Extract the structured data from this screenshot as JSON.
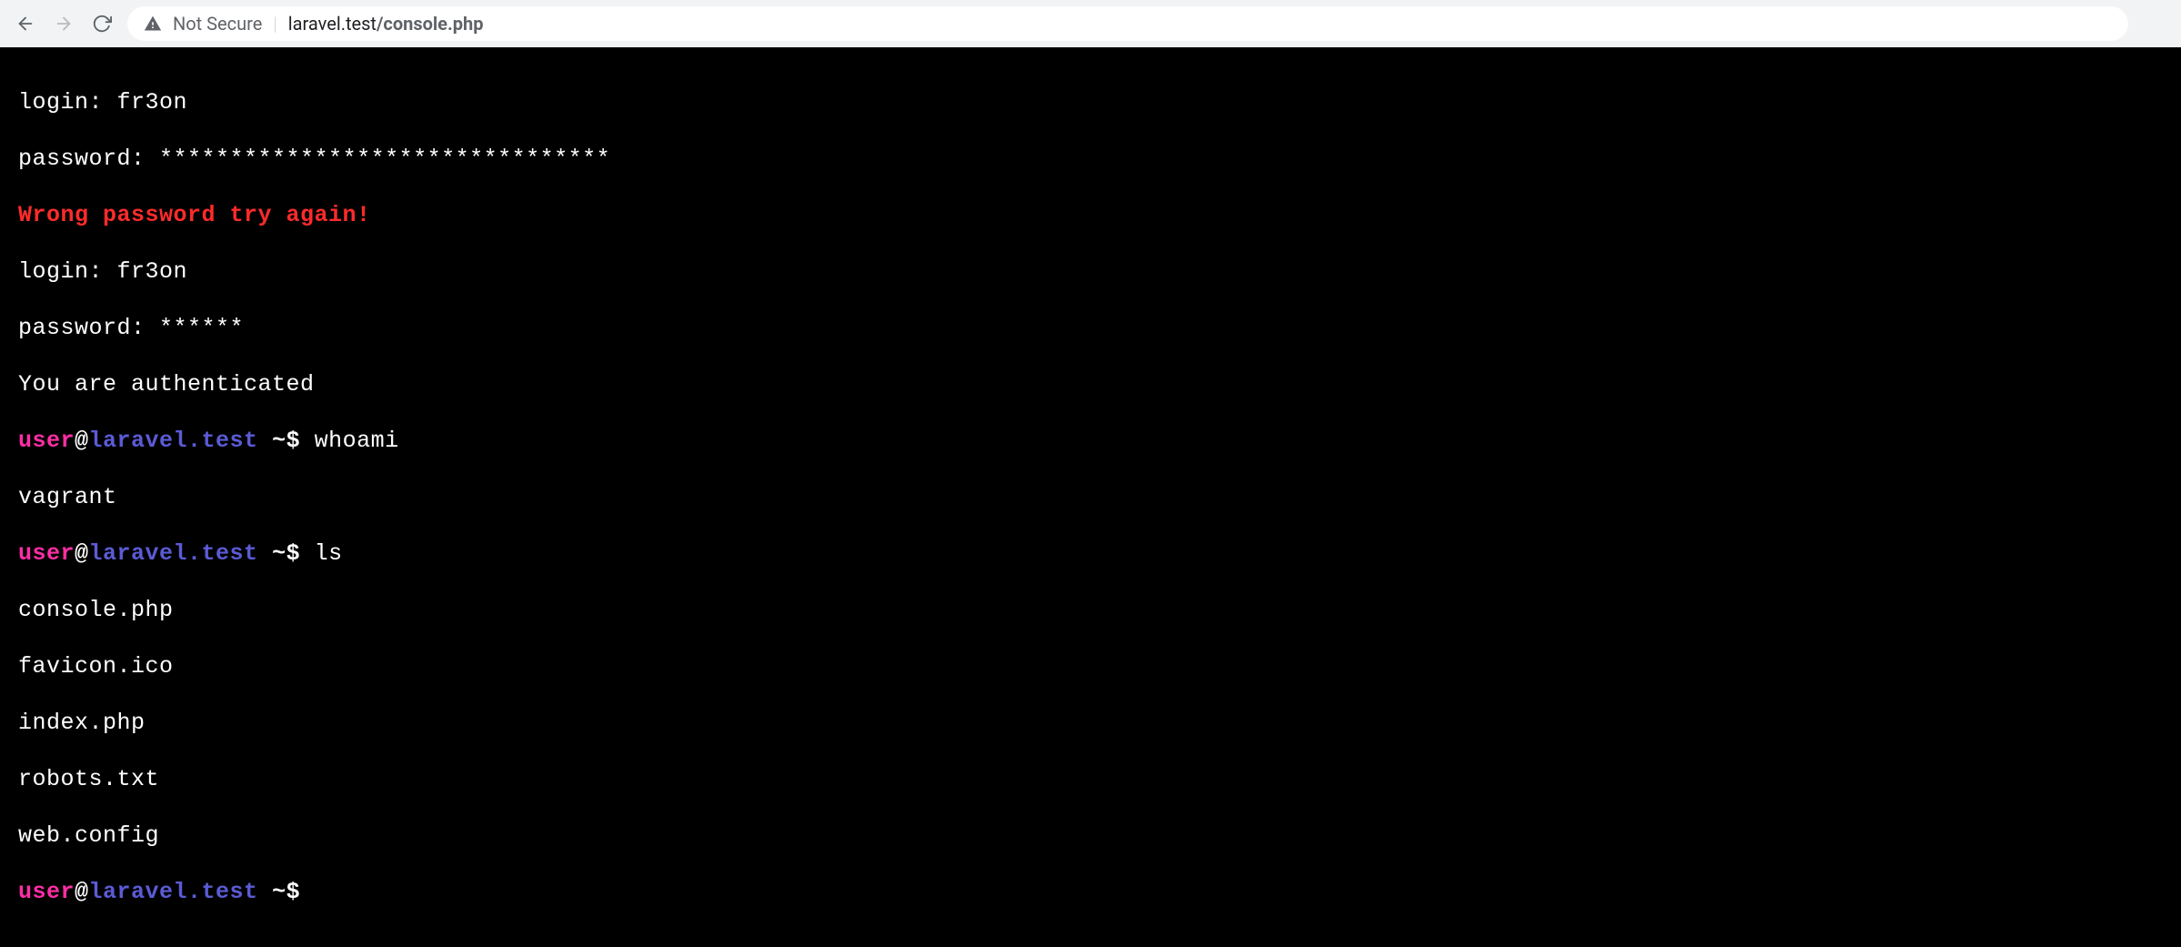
{
  "browser": {
    "security_label": "Not Secure",
    "host": "laravel.test",
    "path": "/console.php"
  },
  "terminal": {
    "login1_label": "login: ",
    "login1_value": "fr3on",
    "password1_label": "password: ",
    "password1_value": "********************************",
    "error_msg": "Wrong password try again!",
    "login2_label": "login: ",
    "login2_value": "fr3on",
    "password2_label": "password: ",
    "password2_value": "******",
    "auth_msg": "You are authenticated",
    "prompt_user": "user",
    "prompt_at": "@",
    "prompt_host": "laravel.test",
    "prompt_path": " ~$ ",
    "cmd1": "whoami",
    "out1": "vagrant",
    "cmd2": "ls",
    "ls_out1": "console.php",
    "ls_out2": "favicon.ico",
    "ls_out3": "index.php",
    "ls_out4": "robots.txt",
    "ls_out5": "web.config",
    "prompt_path_empty": " ~$"
  }
}
